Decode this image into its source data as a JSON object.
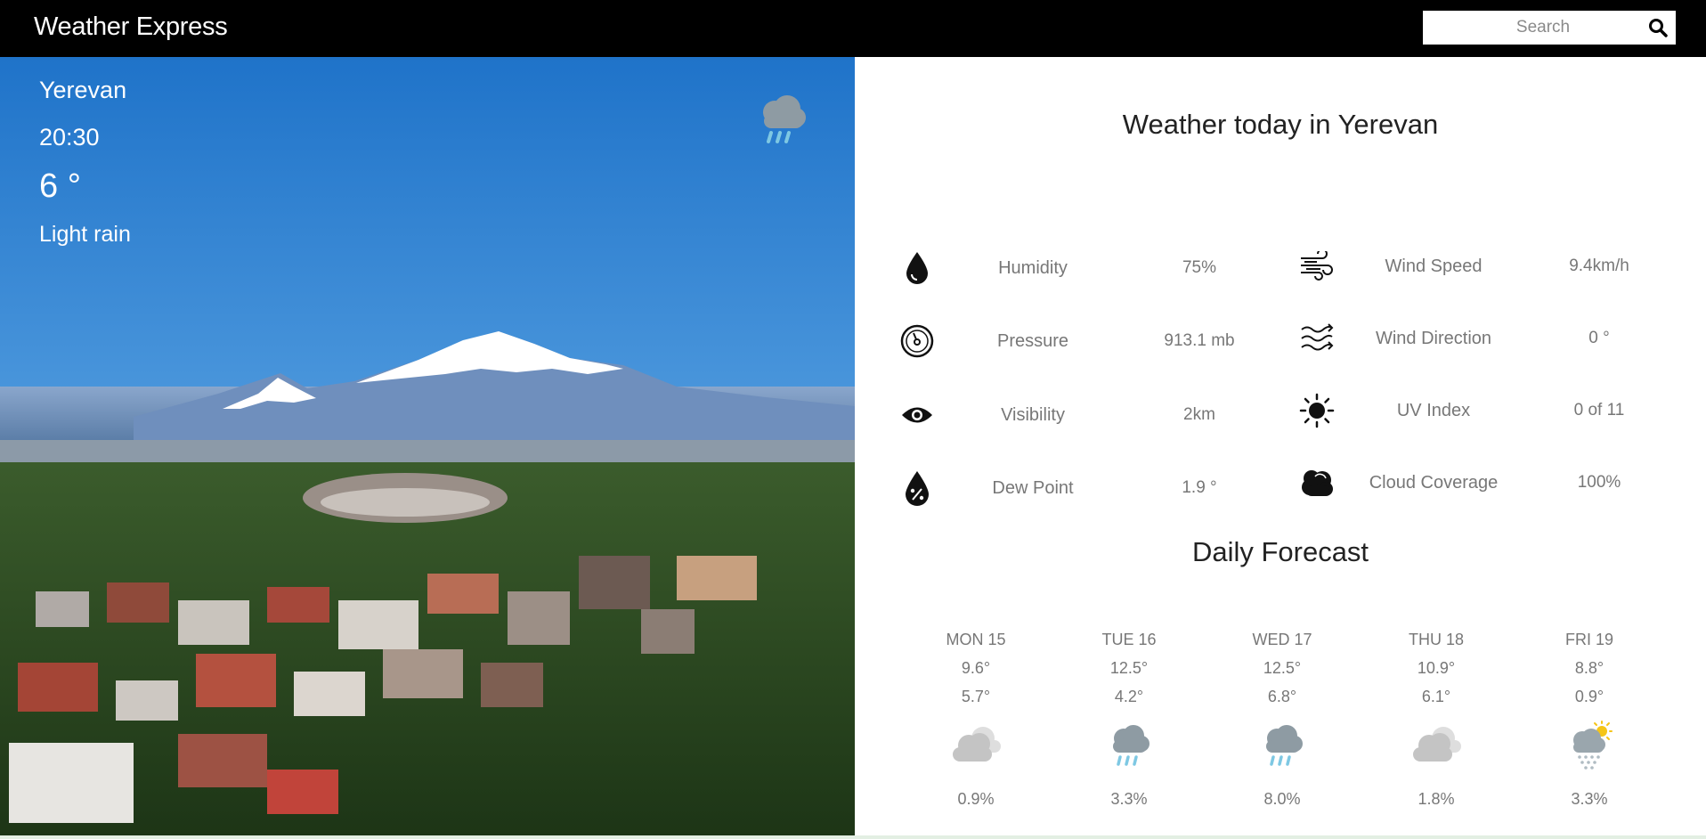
{
  "header": {
    "brand": "Weather Express",
    "search_placeholder": "Search",
    "search_icon": "search-icon"
  },
  "current": {
    "city": "Yerevan",
    "time": "20:30",
    "temperature": "6 °",
    "condition": "Light rain",
    "icon": "rain-cloud-icon"
  },
  "details": {
    "title": "Weather today in Yerevan",
    "left": [
      {
        "label": "Humidity",
        "value": "75%",
        "icon": "droplet-icon"
      },
      {
        "label": "Pressure",
        "value": "913.1 mb",
        "icon": "gauge-icon"
      },
      {
        "label": "Visibility",
        "value": "2km",
        "icon": "eye-icon"
      },
      {
        "label": "Dew Point",
        "value": "1.9 °",
        "icon": "dew-point-icon"
      }
    ],
    "right": [
      {
        "label": "Wind Speed",
        "value": "9.4km/h",
        "icon": "wind-icon"
      },
      {
        "label": "Wind Direction",
        "value": "0 °",
        "icon": "wind-direction-icon"
      },
      {
        "label": "UV Index",
        "value": "0 of 11",
        "icon": "sun-icon"
      },
      {
        "label": "Cloud Coverage",
        "value": "100%",
        "icon": "cloud-icon"
      }
    ]
  },
  "forecast": {
    "title": "Daily Forecast",
    "days": [
      {
        "day": "MON 15",
        "high": "9.6°",
        "low": "5.7°",
        "precip": "0.9%",
        "icon": "cloudy-icon"
      },
      {
        "day": "TUE 16",
        "high": "12.5°",
        "low": "4.2°",
        "precip": "3.3%",
        "icon": "rain-cloud-icon"
      },
      {
        "day": "WED 17",
        "high": "12.5°",
        "low": "6.8°",
        "precip": "8.0%",
        "icon": "rain-cloud-icon"
      },
      {
        "day": "THU 18",
        "high": "10.9°",
        "low": "6.1°",
        "precip": "1.8%",
        "icon": "cloudy-icon"
      },
      {
        "day": "FRI 19",
        "high": "8.8°",
        "low": "0.9°",
        "precip": "3.3%",
        "icon": "snow-sun-icon"
      }
    ]
  },
  "colors": {
    "topbar": "#000000",
    "rain_drop": "#7ec8e3",
    "cloud_dark": "#8e9ba3",
    "cloud_light": "#c9c9c9",
    "sun": "#f5c518"
  }
}
